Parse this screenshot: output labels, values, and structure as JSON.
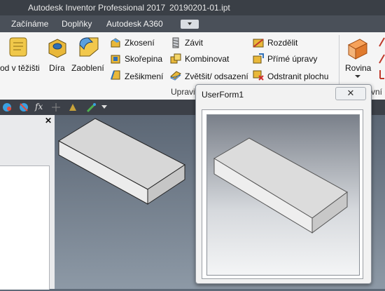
{
  "window": {
    "app_title": "Autodesk Inventor Professional 2017",
    "file_name": "20190201-01.ipt"
  },
  "menu_tabs": [
    "Začínáme",
    "Doplňky",
    "Autodesk A360"
  ],
  "ribbon": {
    "partial_button": "od v těžišti",
    "hole": "Díra",
    "fillet": "Zaoblení",
    "chamfer": "Zkosení",
    "shell": "Skořepina",
    "draft": "Zešikmení",
    "thread": "Závit",
    "combine": "Kombinovat",
    "thicken": "Zvětšit/ odsazení",
    "split": "Rozdělit",
    "direct_edit": "Přímé úpravy",
    "delete_face": "Odstranit plochu",
    "group_modify": "Upravit",
    "plane": "Rovina",
    "partial_right": "vní k"
  },
  "toolbar": {
    "formula_symbol": "fx"
  },
  "panel": {
    "close_symbol": "✕"
  },
  "userform": {
    "title": "UserForm1",
    "close_symbol": "✕"
  },
  "colors": {
    "accent_title": "#3a3f46",
    "tab_bar": "#4a5059",
    "ribbon_bg": "#f5f5f5",
    "viewport_top": "#5b6674"
  }
}
